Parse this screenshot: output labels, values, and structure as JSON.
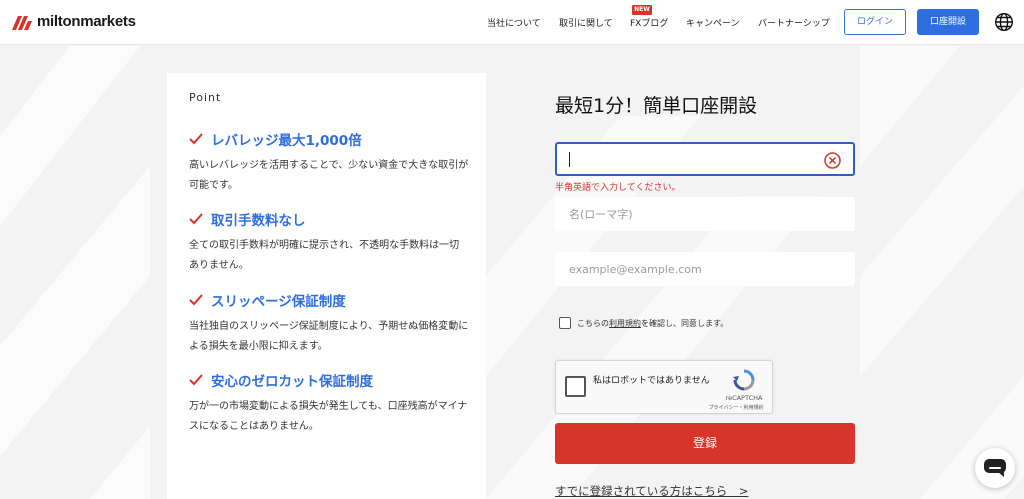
{
  "header": {
    "logo_text": "miltonmarkets",
    "nav": [
      {
        "label": "当社について"
      },
      {
        "label": "取引に関して"
      },
      {
        "label": "FXブログ",
        "badge": "NEW"
      },
      {
        "label": "キャンペーン"
      },
      {
        "label": "パートナーシップ"
      }
    ],
    "login_label": "ログイン",
    "open_account_label": "口座開設",
    "globe_icon": "globe-icon"
  },
  "points": {
    "title": "Point",
    "items": [
      {
        "title": "レバレッジ最大1,000倍",
        "desc": "高いレバレッジを活用することで、少ない資金で大きな取引が可能です。"
      },
      {
        "title": "取引手数料なし",
        "desc": "全ての取引手数料が明確に提示され、不透明な手数料は一切ありません。"
      },
      {
        "title": "スリッページ保証制度",
        "desc": "当社独自のスリッページ保証制度により、予期せぬ価格変動による損失を最小限に抑えます。"
      },
      {
        "title": "安心のゼロカット保証制度",
        "desc": "万が一の市場変動による損失が発生しても、口座残高がマイナスになることはありません。"
      }
    ]
  },
  "form": {
    "title": "最短1分！簡単口座開設",
    "lastname_value": "",
    "error_message": "半角英語で入力してください。",
    "firstname_placeholder": "名(ローマ字)",
    "email_placeholder": "example@example.com",
    "terms_prefix": "こちらの",
    "terms_link": "利用規約",
    "terms_suffix": "を確認し、同意します。",
    "captcha_label": "私はロボットではありません",
    "captcha_brand": "reCAPTCHA",
    "captcha_links": "プライバシー・利用規約",
    "register_label": "登録",
    "login_link": "すでに登録されている方はこちら　>"
  },
  "colors": {
    "accent_blue": "#2f6ee0",
    "accent_red": "#d8342a"
  }
}
